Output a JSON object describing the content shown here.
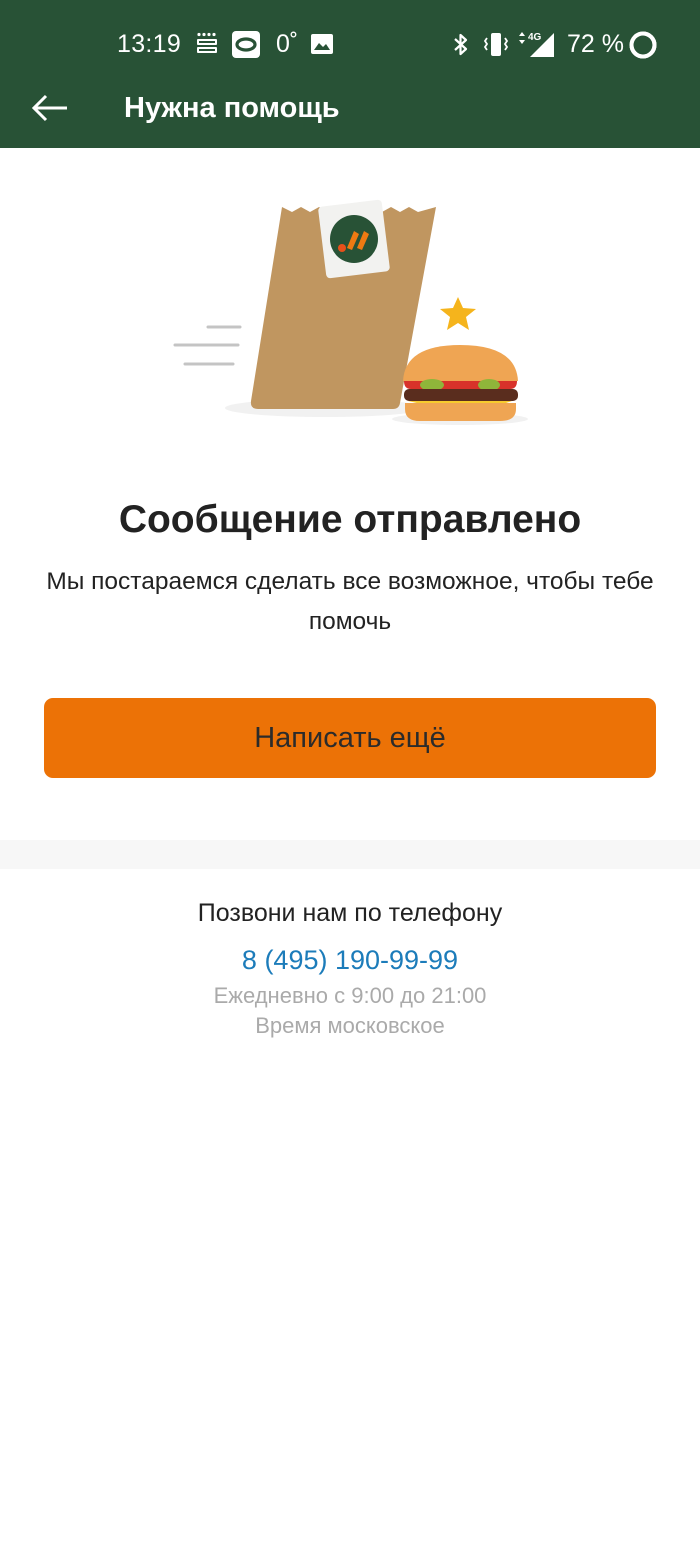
{
  "status_bar": {
    "time": "13:19",
    "temperature": "0˚",
    "battery_percent": "72 %",
    "network": "4G",
    "icons": [
      "detmir-icon",
      "ok-icon",
      "gallery-icon",
      "bluetooth-icon",
      "vibrate-icon",
      "signal-icon",
      "battery-icon"
    ]
  },
  "app_bar": {
    "title": "Нужна помощь",
    "back_icon": "arrow-left-icon"
  },
  "main": {
    "title": "Сообщение отправлено",
    "subtitle": "Мы постараемся сделать все возможное, чтобы тебе помочь",
    "button_label": "Написать ещё"
  },
  "contact": {
    "heading": "Позвони нам по телефону",
    "phone": "8 (495) 190-99-99",
    "hours": "Ежедневно с 9:00 до 21:00",
    "timezone": "Время московское"
  },
  "colors": {
    "header": "#285236",
    "accent_button": "#ec7206",
    "phone_link": "#1c7cba",
    "muted_text": "#aaaaaa"
  }
}
